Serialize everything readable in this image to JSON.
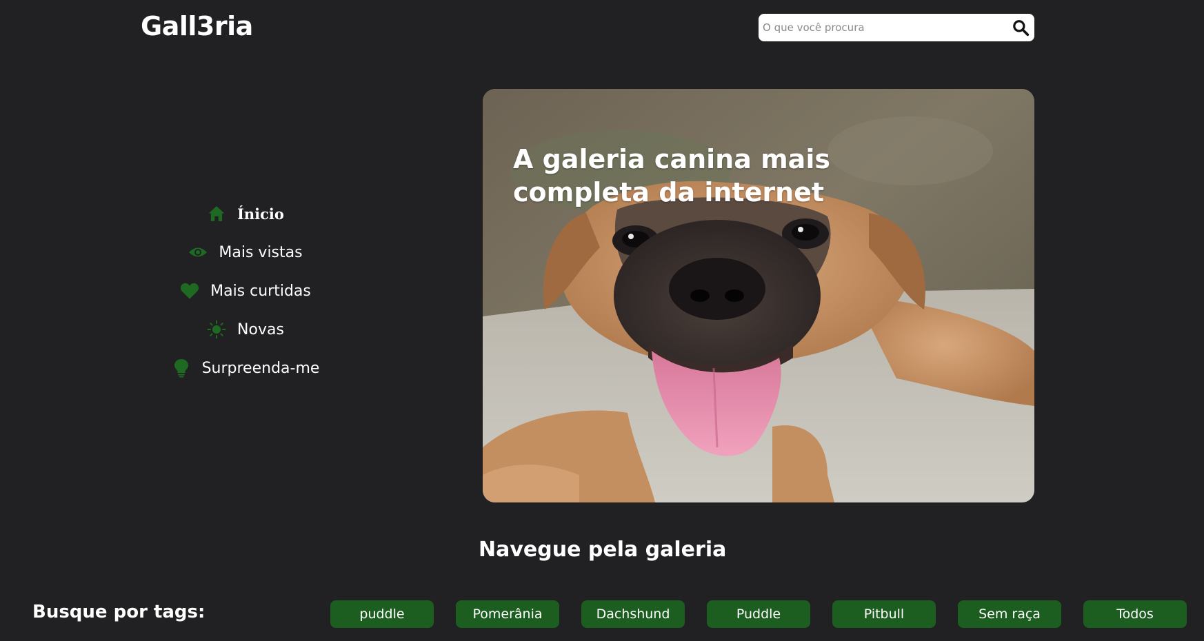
{
  "header": {
    "logo": "Gall3ria",
    "search": {
      "placeholder": "O que você procura",
      "value": "",
      "icon": "search-icon"
    }
  },
  "sidebar": {
    "items": [
      {
        "label": "Ínicio",
        "icon": "home-icon",
        "active": true
      },
      {
        "label": "Mais vistas",
        "icon": "eye-icon",
        "active": false
      },
      {
        "label": "Mais curtidas",
        "icon": "heart-icon",
        "active": false
      },
      {
        "label": "Novas",
        "icon": "sun-icon",
        "active": false
      },
      {
        "label": "Surpreenda-me",
        "icon": "lightbulb-icon",
        "active": false
      }
    ]
  },
  "hero": {
    "title": "A galeria canina mais completa da internet"
  },
  "gallery": {
    "title": "Navegue pela galeria"
  },
  "tags": {
    "label": "Busque por tags:",
    "items": [
      "puddle",
      "Pomerânia",
      "Dachshund",
      "Puddle",
      "Pitbull",
      "Sem raça",
      "Todos"
    ]
  },
  "colors": {
    "background": "#212022",
    "accent": "#1b5e1f",
    "icon": "#1e6a23",
    "text": "#ffffff"
  }
}
